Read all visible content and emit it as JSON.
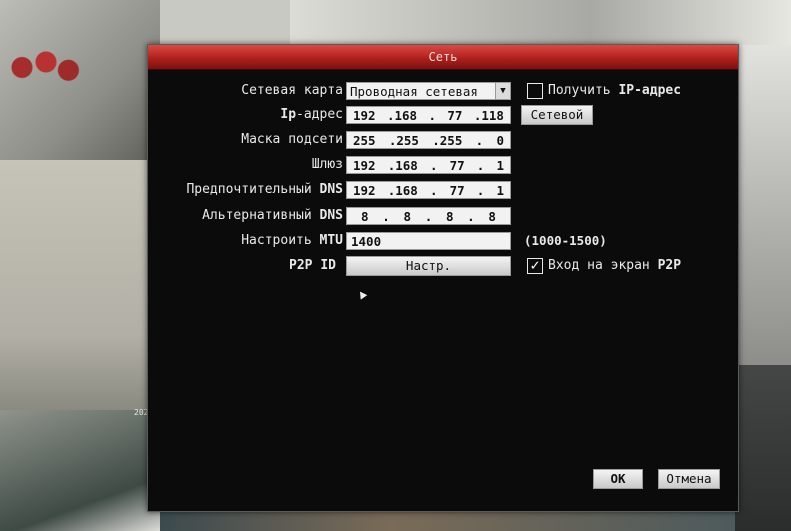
{
  "dialog": {
    "title": "Сеть",
    "fields": {
      "network_card": {
        "label": "Сетевая карта",
        "value": "Проводная сетевая"
      },
      "ip": {
        "label_pre": "Ip",
        "label_post": "-адрес",
        "octets": [
          "192",
          ".168",
          ".",
          "77",
          ".118"
        ]
      },
      "mask": {
        "label": "Маска подсети",
        "octets": [
          "255",
          ".255",
          ".255",
          ".",
          "0"
        ]
      },
      "gateway": {
        "label": "Шлюз",
        "octets": [
          "192",
          ".168",
          ".",
          "77",
          ".",
          "1"
        ]
      },
      "preferred_dns": {
        "label_pre": "Предпочтительный ",
        "label_post": "DNS",
        "octets": [
          "192",
          ".168",
          ".",
          "77",
          ".",
          "1"
        ]
      },
      "alt_dns": {
        "label_pre": "Альтернативный ",
        "label_post": "DNS",
        "octets": [
          "8",
          ".",
          "8",
          ".",
          "8",
          ".",
          "8"
        ]
      },
      "mtu": {
        "label_pre": "Настроить ",
        "label_post": "MTU",
        "value": "1400",
        "range": "(1000-1500)"
      },
      "p2p": {
        "label": "P2P ID",
        "button": "Настр."
      }
    },
    "get_ip": {
      "label_pre": "Получить ",
      "label_post": "IP-адрес",
      "checked": false
    },
    "network_button": "Сетевой",
    "p2p_login": {
      "label_pre": "Вход на экран ",
      "label_post": "P2P",
      "checked": true
    },
    "ok_button": "OK",
    "cancel_button": "Отмена"
  },
  "background": {
    "clock_text": "202"
  },
  "colors": {
    "titlebar": "#b0201d",
    "dialog_bg": "#0b0b0b",
    "field_bg": "#f2f2f2"
  },
  "icons": {
    "dropdown": "chevron-down-icon",
    "checkmark": "check-icon",
    "cursor": "mouse-pointer-icon"
  }
}
